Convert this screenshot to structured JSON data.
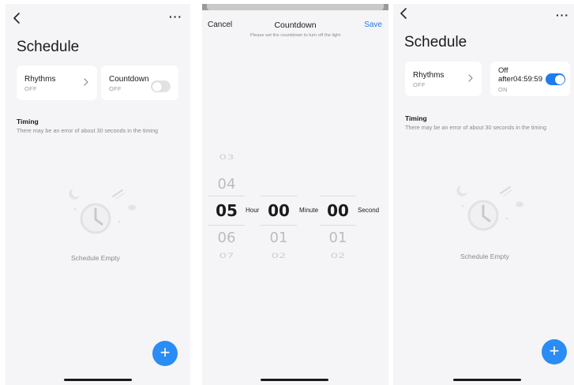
{
  "left": {
    "title": "Schedule",
    "more_label": "···",
    "cards": {
      "rhythms": {
        "title": "Rhythms",
        "status": "OFF"
      },
      "countdown": {
        "title": "Countdown",
        "status": "OFF",
        "enabled": false
      }
    },
    "timing": {
      "title": "Timing",
      "description": "There may be an error of about 30 seconds in the timing"
    },
    "empty_text": "Schedule Empty",
    "fab_label": "+"
  },
  "middle": {
    "cancel_label": "Cancel",
    "title": "Countdown",
    "save_label": "Save",
    "hint": "Please set the countdown to turn off the light",
    "picker": {
      "hour": {
        "above": [
          "03",
          "04"
        ],
        "selected": "05",
        "below": [
          "06",
          "07"
        ],
        "unit": "Hour"
      },
      "minute": {
        "selected": "00",
        "below": [
          "01",
          "02"
        ],
        "unit": "Minute"
      },
      "second": {
        "selected": "00",
        "below": [
          "01",
          "02"
        ],
        "unit": "Second"
      }
    }
  },
  "right": {
    "title": "Schedule",
    "more_label": "···",
    "cards": {
      "rhythms": {
        "title": "Rhythms",
        "status": "OFF"
      },
      "countdown": {
        "title_line1": "Off",
        "title_line2": "after04:59:59",
        "status": "ON",
        "enabled": true
      }
    },
    "timing": {
      "title": "Timing",
      "description": "There may be an error of about 30 seconds in the timing"
    },
    "empty_text": "Schedule Empty",
    "fab_label": "+"
  },
  "colors": {
    "accent": "#1f7cf0",
    "fab": "#2a8cf5",
    "background": "#f5f5f7",
    "card": "#ffffff"
  },
  "icons": [
    "back-chevron-icon",
    "more-dots-icon",
    "chevron-right-icon",
    "alarm-clock-illustration",
    "plus-icon"
  ]
}
